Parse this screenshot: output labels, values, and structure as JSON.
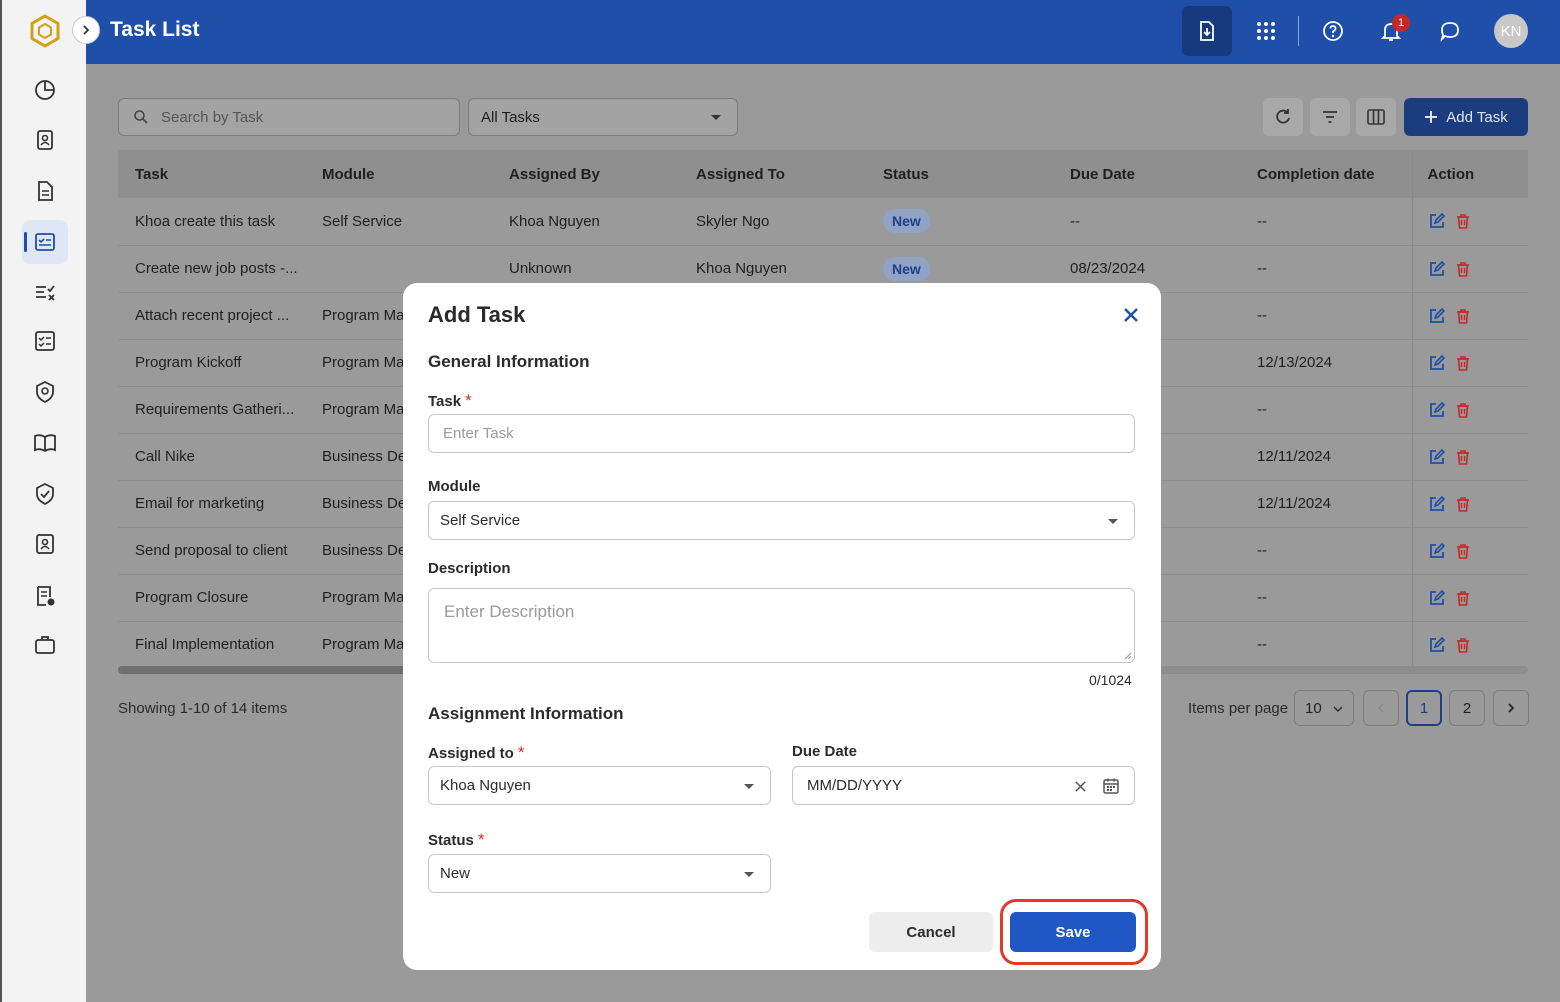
{
  "header": {
    "title": "Task List",
    "notification_count": "1",
    "avatar_initials": "KN"
  },
  "toolbar": {
    "search_placeholder": "Search by Task",
    "filter_value": "All Tasks",
    "add_task_label": "Add Task"
  },
  "table": {
    "columns": [
      "Task",
      "Module",
      "Assigned By",
      "Assigned To",
      "Status",
      "Due Date",
      "Completion date",
      "Action"
    ],
    "rows": [
      {
        "task": "Khoa create this task",
        "module": "Self Service",
        "assigned_by": "Khoa Nguyen",
        "assigned_to": "Skyler Ngo",
        "status": "New",
        "due": "--",
        "completion": "--"
      },
      {
        "task": "Create new job posts -...",
        "module": "",
        "assigned_by": "Unknown",
        "assigned_to": "Khoa Nguyen",
        "status": "New",
        "due": "08/23/2024",
        "completion": "--"
      },
      {
        "task": "Attach recent project ...",
        "module": "Program Ma",
        "assigned_by": "",
        "assigned_to": "",
        "status": "",
        "due": "",
        "completion": "--"
      },
      {
        "task": "Program Kickoff",
        "module": "Program Ma",
        "assigned_by": "",
        "assigned_to": "",
        "status": "",
        "due": "",
        "completion": "12/13/2024"
      },
      {
        "task": "Requirements Gatheri...",
        "module": "Program Ma",
        "assigned_by": "",
        "assigned_to": "",
        "status": "",
        "due": "",
        "completion": "--"
      },
      {
        "task": "Call Nike",
        "module": "Business De",
        "assigned_by": "",
        "assigned_to": "",
        "status": "",
        "due": "",
        "completion": "12/11/2024"
      },
      {
        "task": "Email for marketing",
        "module": "Business De",
        "assigned_by": "",
        "assigned_to": "",
        "status": "",
        "due": "",
        "completion": "12/11/2024"
      },
      {
        "task": "Send proposal to client",
        "module": "Business De",
        "assigned_by": "",
        "assigned_to": "",
        "status": "",
        "due": "",
        "completion": "--"
      },
      {
        "task": "Program Closure",
        "module": "Program Ma",
        "assigned_by": "",
        "assigned_to": "",
        "status": "",
        "due": "",
        "completion": "--"
      },
      {
        "task": "Final Implementation",
        "module": "Program Ma",
        "assigned_by": "",
        "assigned_to": "",
        "status": "",
        "due": "",
        "completion": "--"
      }
    ]
  },
  "pagination": {
    "showing": "Showing 1-10 of 14 items",
    "items_per_page_label": "Items per page",
    "items_per_page": "10",
    "pages": [
      "1",
      "2"
    ]
  },
  "modal": {
    "title": "Add Task",
    "general_section": "General Information",
    "task_label": "Task",
    "task_placeholder": "Enter Task",
    "module_label": "Module",
    "module_value": "Self Service",
    "description_label": "Description",
    "description_placeholder": "Enter Description",
    "description_counter": "0/1024",
    "assignment_section": "Assignment Information",
    "assigned_to_label": "Assigned to",
    "assigned_to_value": "Khoa Nguyen",
    "due_date_label": "Due Date",
    "due_date_placeholder": "MM/DD/YYYY",
    "status_label": "Status",
    "status_value": "New",
    "required_mark": "*",
    "cancel_label": "Cancel",
    "save_label": "Save"
  },
  "colors": {
    "primary": "#1f4fa8",
    "save": "#2157c4",
    "highlight": "#e03a2a",
    "delete": "#c62828"
  }
}
